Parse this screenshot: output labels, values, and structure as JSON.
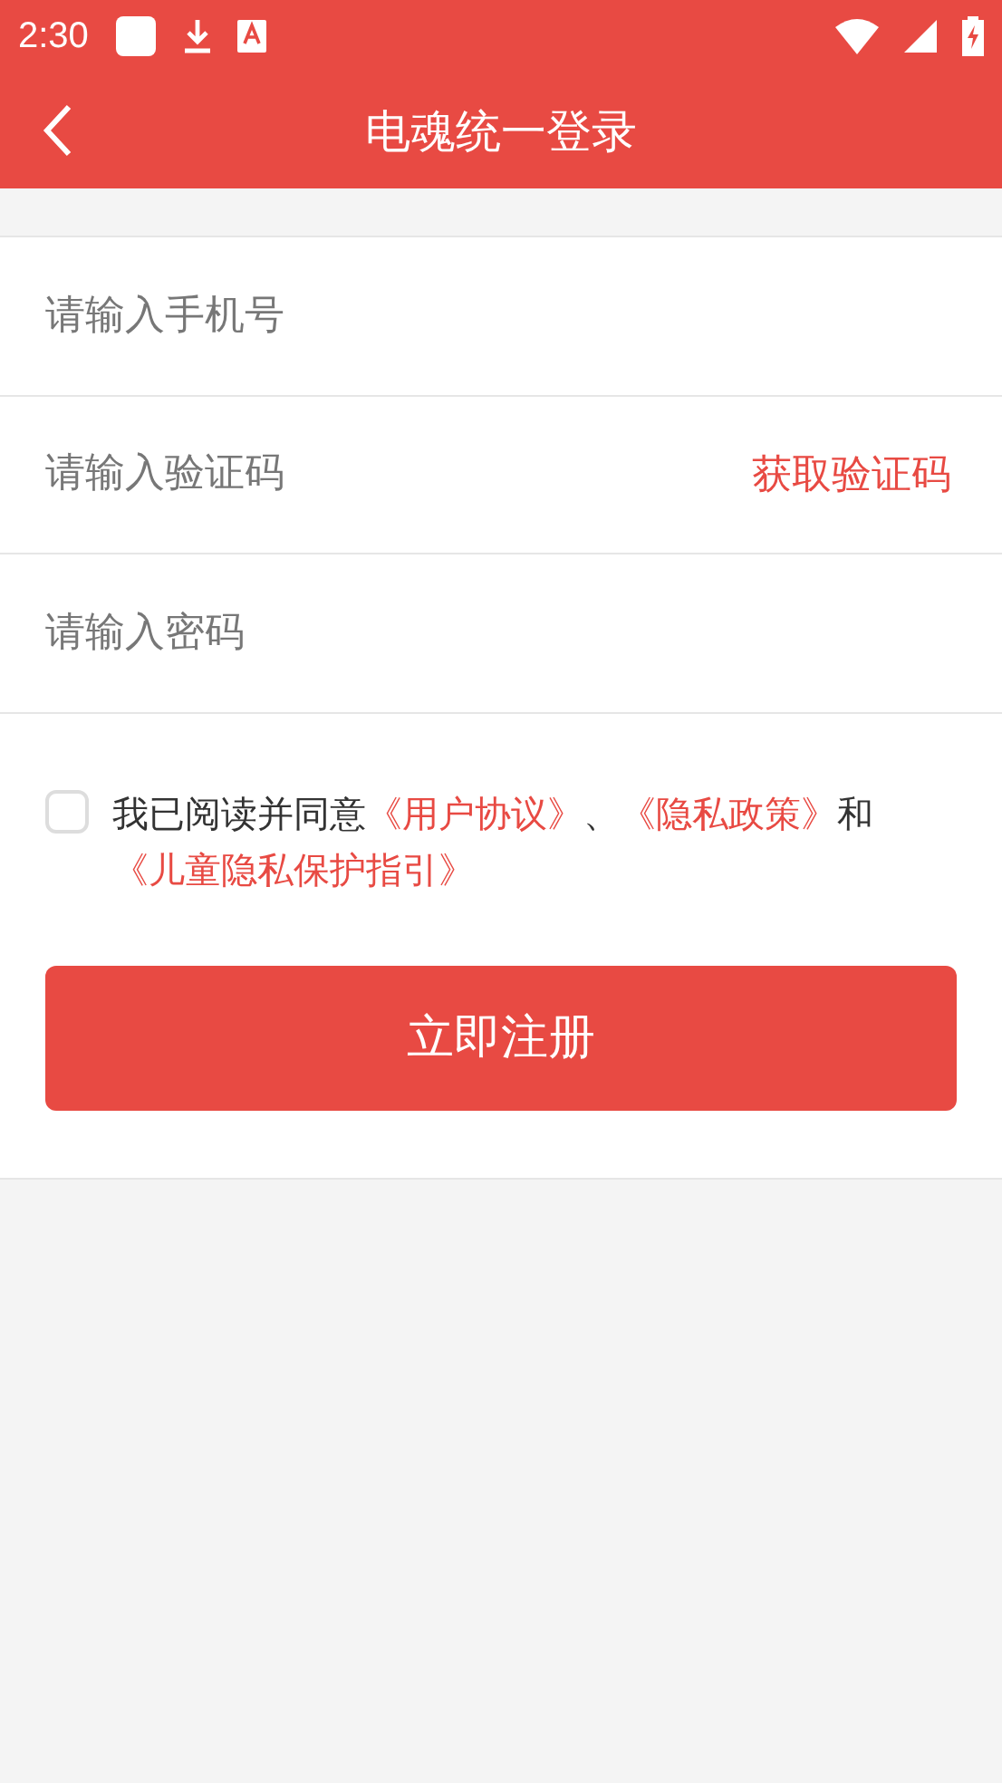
{
  "status_bar": {
    "time": "2:30"
  },
  "toolbar": {
    "title": "电魂统一登录"
  },
  "fields": [
    {
      "placeholder": "请输入手机号"
    },
    {
      "placeholder": "请输入验证码",
      "action": "获取验证码"
    },
    {
      "placeholder": "请输入密码"
    }
  ],
  "agreement": {
    "checked": false,
    "parts": [
      {
        "kind": "text",
        "text": "我已阅读并同意"
      },
      {
        "kind": "link",
        "text": "《用户协议》"
      },
      {
        "kind": "text",
        "text": "、"
      },
      {
        "kind": "link",
        "text": "《隐私政策》"
      },
      {
        "kind": "text",
        "text": "和"
      },
      {
        "kind": "link",
        "text": "《儿童隐私保护指引》"
      }
    ]
  },
  "submit": {
    "label": "立即注册"
  }
}
